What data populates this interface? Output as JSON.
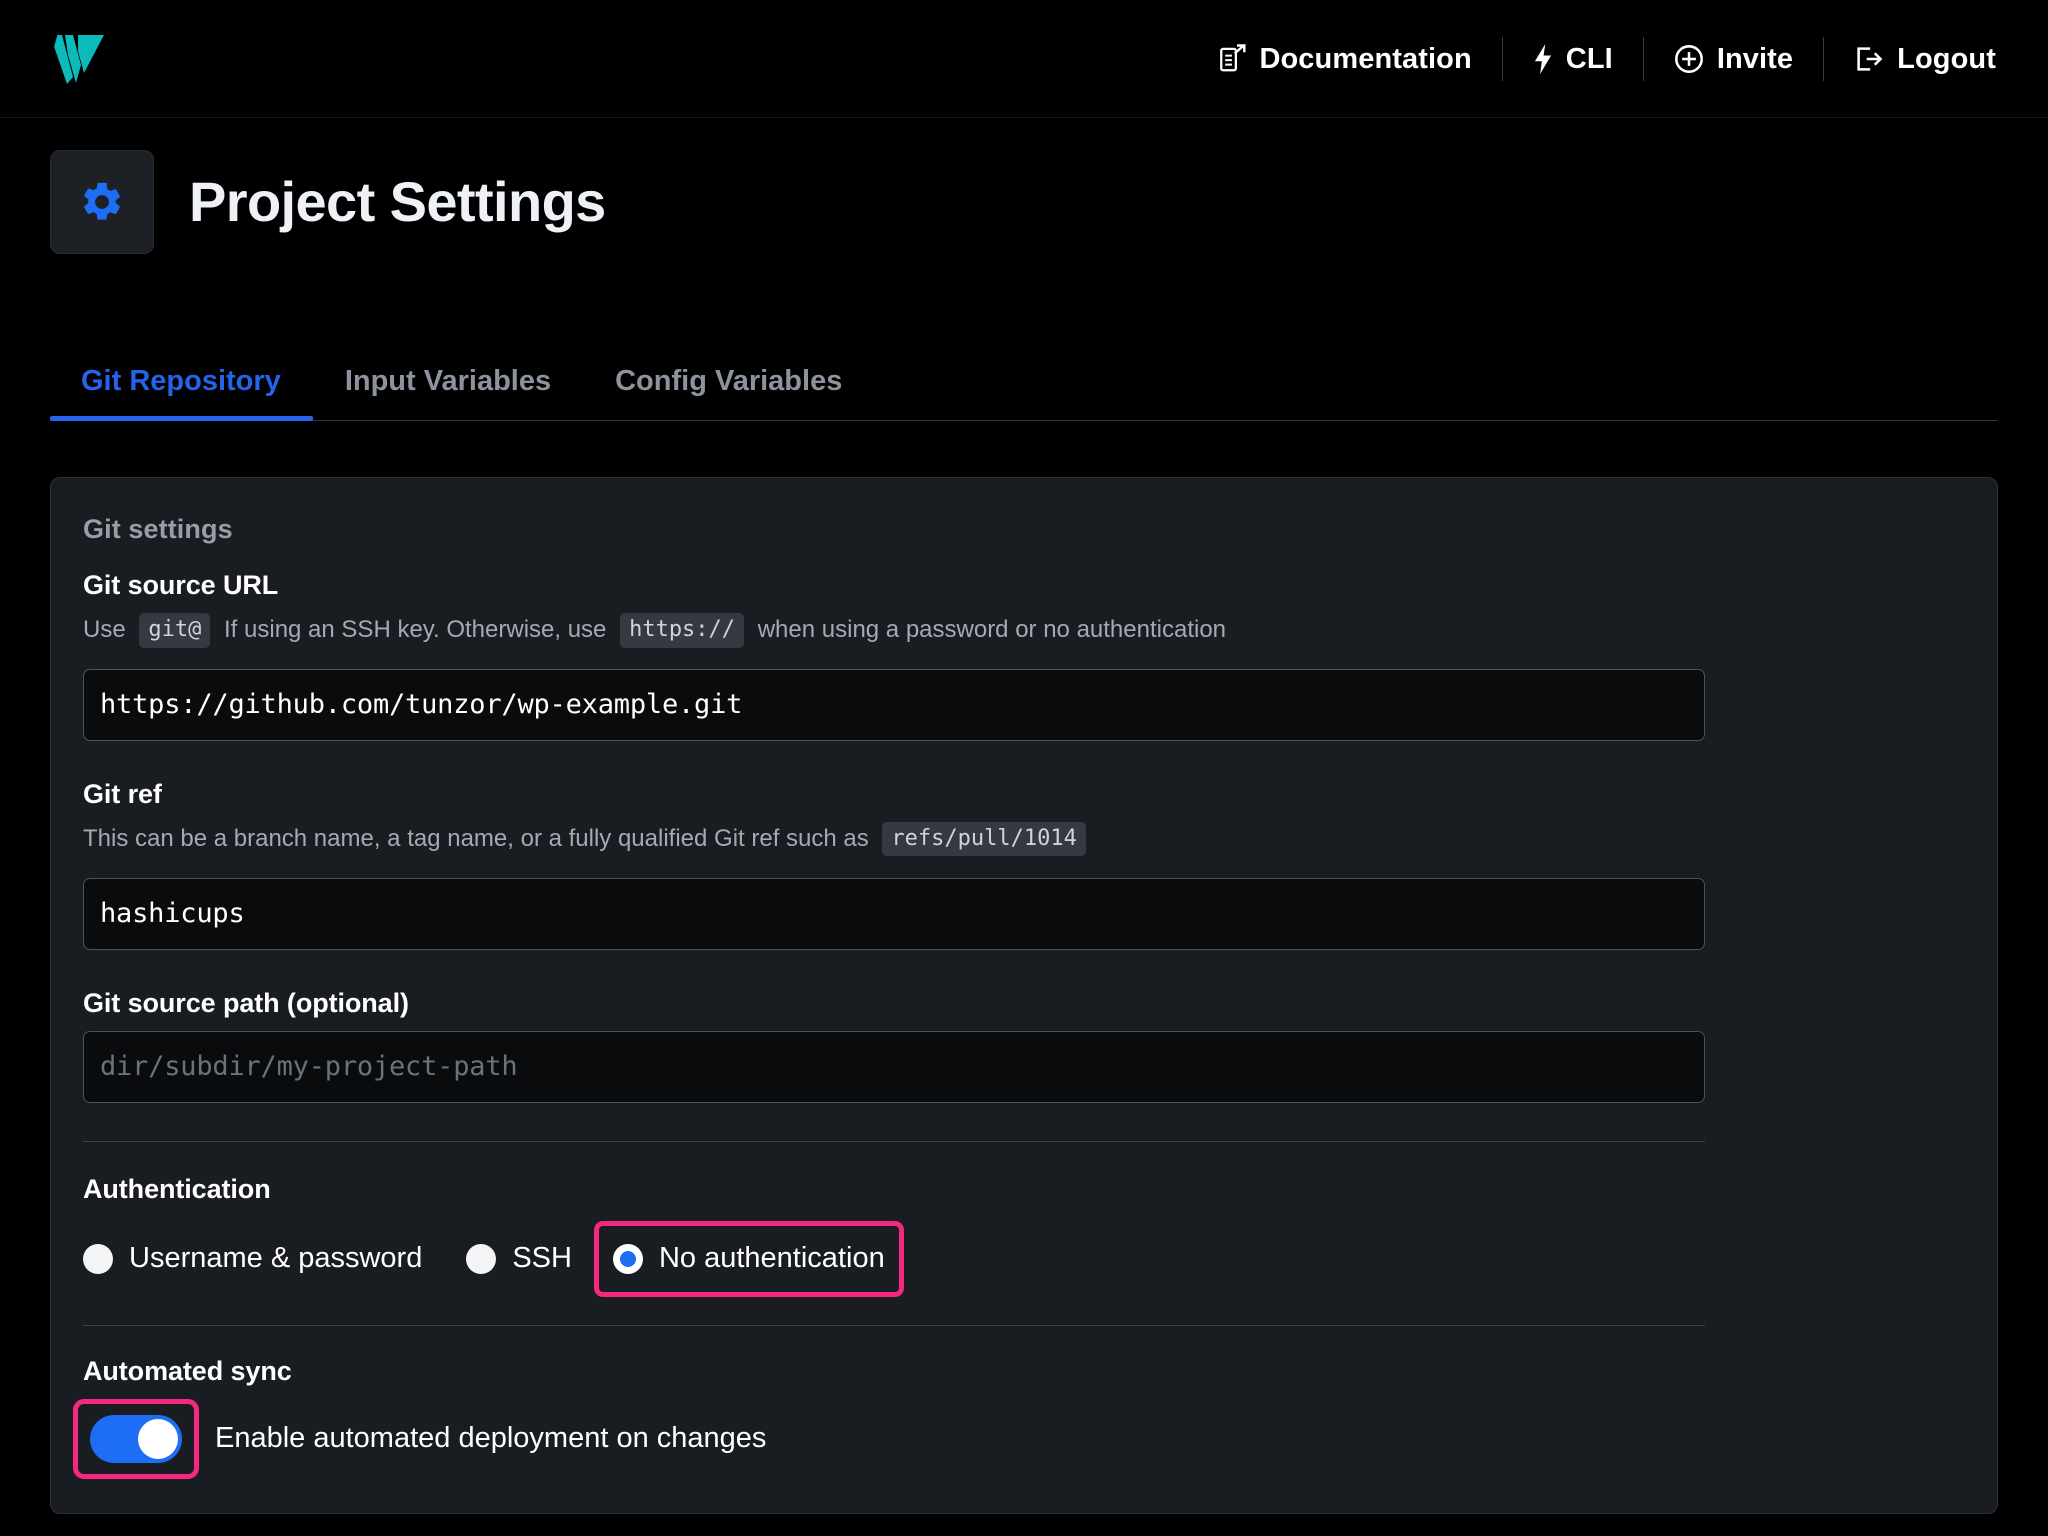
{
  "brand": {
    "logo_icon": "wing-logo-icon",
    "logo_color": "#0cbaba"
  },
  "topnav": {
    "items": [
      {
        "label": "Documentation",
        "icon": "document-external-link-icon"
      },
      {
        "label": "CLI",
        "icon": "lightning-bolt-icon"
      },
      {
        "label": "Invite",
        "icon": "plus-circle-icon"
      },
      {
        "label": "Logout",
        "icon": "logout-arrow-icon"
      }
    ]
  },
  "header": {
    "title": "Project Settings",
    "icon": "gear-icon",
    "icon_color": "#1d6ef5"
  },
  "tabs": [
    {
      "label": "Git Repository",
      "active": true
    },
    {
      "label": "Input Variables",
      "active": false
    },
    {
      "label": "Config Variables",
      "active": false
    }
  ],
  "card": {
    "section_title": "Git settings",
    "git_source_url": {
      "label": "Git source URL",
      "help_prefix": "Use ",
      "help_chip_1": "git@",
      "help_middle": " If using an SSH key. Otherwise, use ",
      "help_chip_2": "https://",
      "help_suffix": " when using a password or no authentication",
      "value": "https://github.com/tunzor/wp-example.git",
      "placeholder": ""
    },
    "git_ref": {
      "label": "Git ref",
      "help_prefix": "This can be a branch name, a tag name, or a fully qualified Git ref such as ",
      "help_chip_1": "refs/pull/1014",
      "help_suffix": "",
      "value": "hashicups",
      "placeholder": ""
    },
    "git_source_path": {
      "label": "Git source path (optional)",
      "value": "",
      "placeholder": "dir/subdir/my-project-path"
    },
    "authentication": {
      "label": "Authentication",
      "options": [
        {
          "label": "Username & password",
          "selected": false,
          "highlighted": false
        },
        {
          "label": "SSH",
          "selected": false,
          "highlighted": false
        },
        {
          "label": "No authentication",
          "selected": true,
          "highlighted": true
        }
      ]
    },
    "automated_sync": {
      "label": "Automated sync",
      "toggle_label": "Enable automated deployment on changes",
      "enabled": true,
      "highlighted": true
    }
  },
  "highlight_color": "#f5277f",
  "accent_color": "#1d6ef5"
}
